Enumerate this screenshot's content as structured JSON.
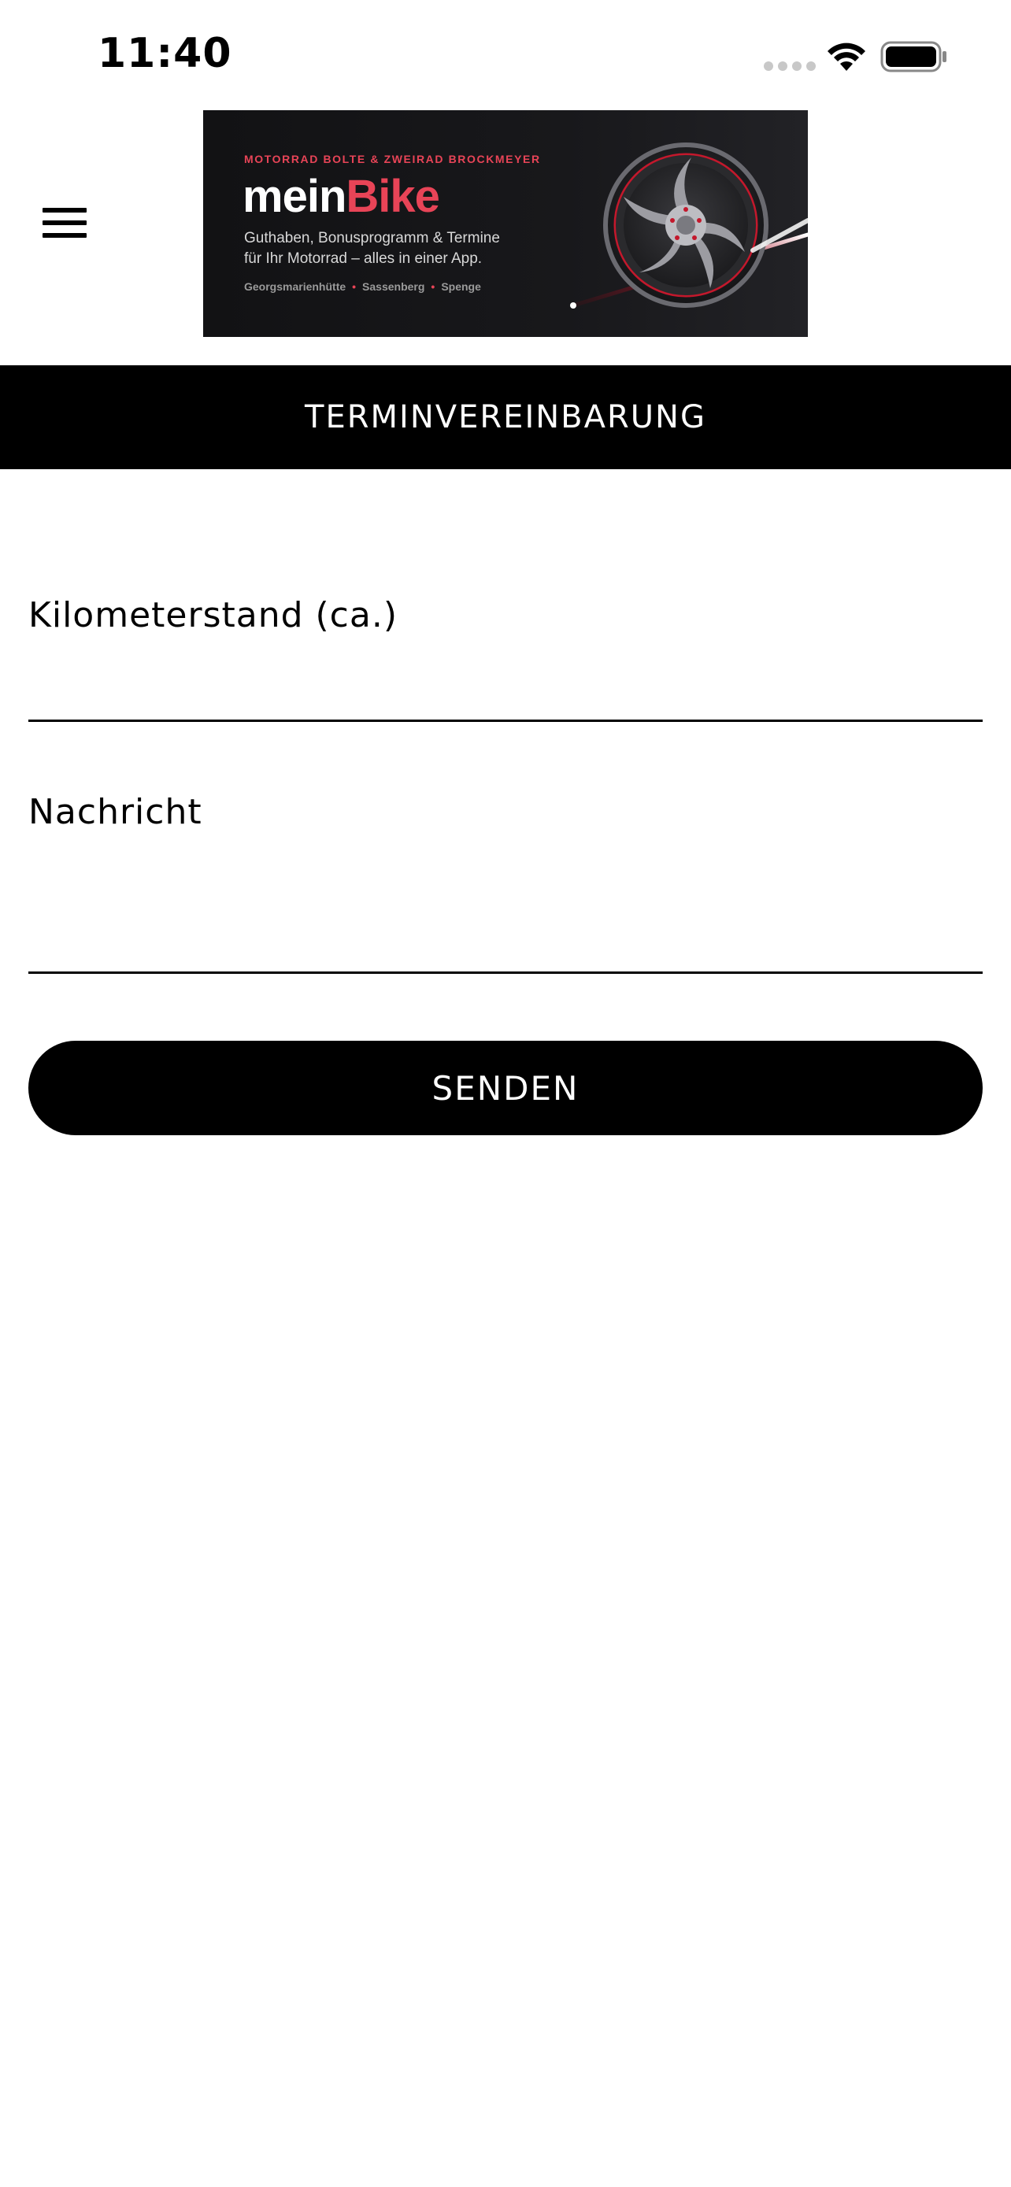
{
  "status_bar": {
    "time": "11:40"
  },
  "header": {
    "menu_icon": "hamburger-menu-icon",
    "banner": {
      "kicker": "MOTORRAD BOLTE & ZWEIRAD BROCKMEYER",
      "logo_part1": "mein",
      "logo_part2": "Bike",
      "tagline_line1": "Guthaben, Bonusprogramm & Termine",
      "tagline_line2": "für Ihr Motorrad – alles in einer App.",
      "locations": [
        "Georgsmarienhütte",
        "Sassenberg",
        "Spenge"
      ]
    }
  },
  "title_bar": {
    "title": "TERMINVEREINBARUNG"
  },
  "form": {
    "mileage_label": "Kilometerstand (ca.)",
    "mileage_value": "",
    "message_label": "Nachricht",
    "message_value": "",
    "submit_label": "SENDEN"
  },
  "colors": {
    "accent": "#e84457",
    "primary": "#000000",
    "background": "#ffffff"
  }
}
